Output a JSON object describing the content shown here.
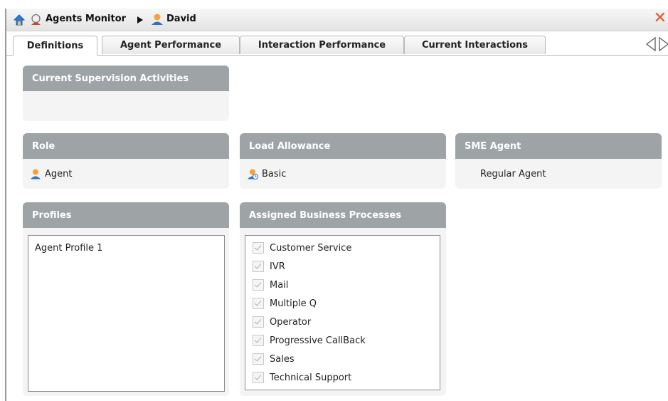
{
  "titlebar": {
    "app": "Agents Monitor",
    "agent": "David"
  },
  "tabs": [
    {
      "label": "Definitions",
      "active": true
    },
    {
      "label": "Agent Performance"
    },
    {
      "label": "Interaction Performance"
    },
    {
      "label": "Current Interactions"
    }
  ],
  "supervision": {
    "title": "Current Supervision Activities"
  },
  "role": {
    "title": "Role",
    "value": "Agent"
  },
  "load": {
    "title": "Load Allowance",
    "value": "Basic"
  },
  "sme": {
    "title": "SME Agent",
    "value": "Regular Agent"
  },
  "profiles": {
    "title": "Profiles",
    "items": [
      "Agent Profile 1"
    ]
  },
  "processes": {
    "title": "Assigned Business Processes",
    "items": [
      "Customer Service",
      "IVR",
      "Mail",
      "Multiple Q",
      "Operator",
      "Progressive CallBack",
      "Sales",
      "Technical Support"
    ]
  }
}
